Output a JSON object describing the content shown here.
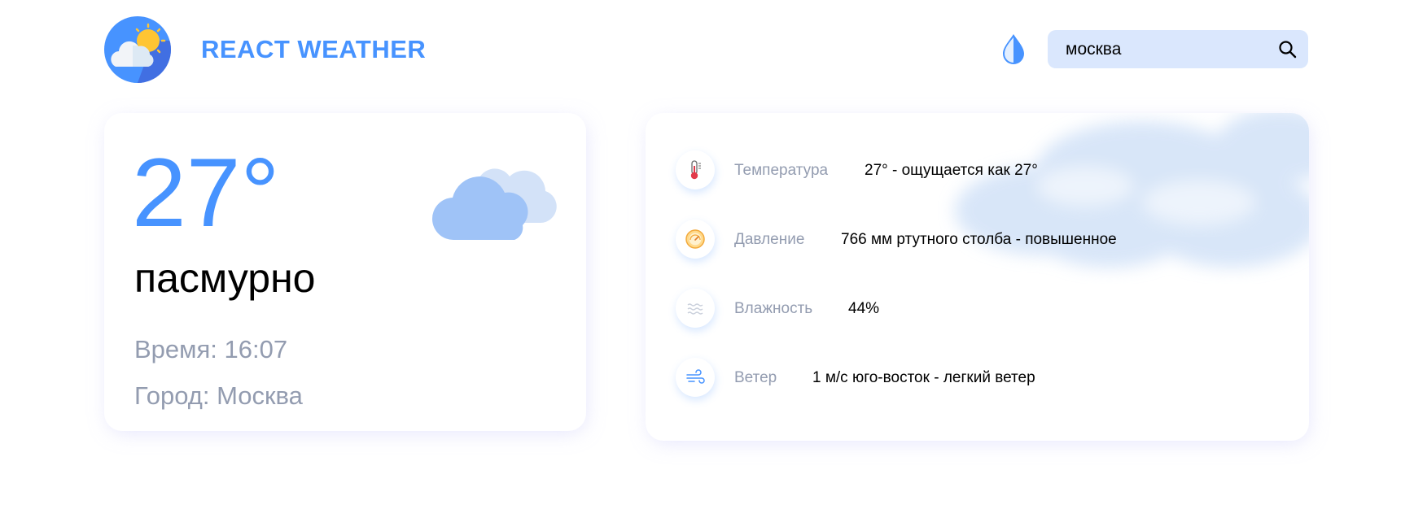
{
  "header": {
    "title": "REACT WEATHER",
    "logo_icon": "sun-cloud-logo-icon",
    "theme_toggle_icon": "drop-icon",
    "search": {
      "value": "москва",
      "icon": "search-icon"
    }
  },
  "today": {
    "temperature": "27°",
    "condition": "пасмурно",
    "time": "Время: 16:07",
    "city": "Город: Москва",
    "icon": "cloud-icon"
  },
  "details": [
    {
      "icon": "thermometer-icon",
      "label": "Температура",
      "value": "27° - ощущается как 27°"
    },
    {
      "icon": "pressure-gauge-icon",
      "label": "Давление",
      "value": "766 мм ртутного столба - повышенное"
    },
    {
      "icon": "humidity-icon",
      "label": "Влажность",
      "value": "44%"
    },
    {
      "icon": "wind-icon",
      "label": "Ветер",
      "value": "1 м/с юго-восток - легкий ветер"
    }
  ],
  "colors": {
    "accent": "#4793ff",
    "muted_text": "#939cb0",
    "search_bg": "#dae7fd",
    "card_bg": "#ffffff"
  }
}
